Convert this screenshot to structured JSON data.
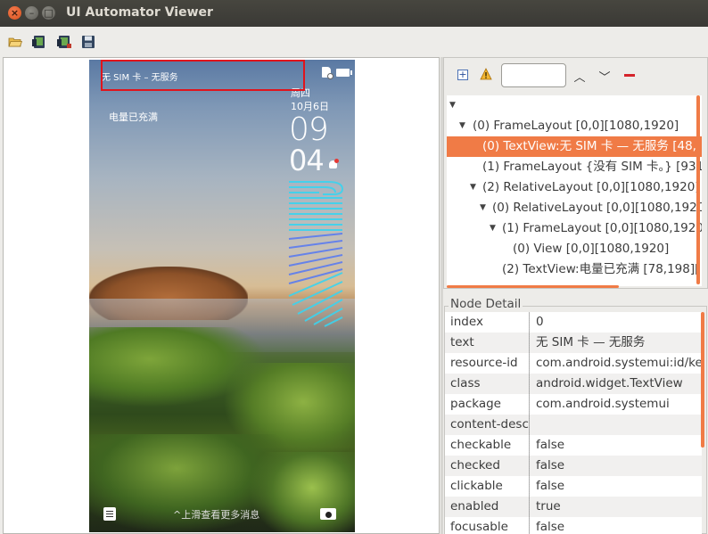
{
  "window": {
    "title": "UI Automator Viewer",
    "close_glyph": "×",
    "minimize_glyph": "–",
    "maximize_glyph": "□"
  },
  "toolbar": {
    "icons": [
      "open-folder-icon",
      "device-screenshot-icon",
      "device-screenshot-compressed-icon",
      "save-icon"
    ]
  },
  "device": {
    "status_text": "无 SIM 卡 – 无服务",
    "weekday": "周四",
    "date": "10月6日",
    "hour": "09",
    "minute": "04",
    "charge_text": "电量已充满",
    "swipe_hint": "^上滑查看更多消息"
  },
  "tree_toolbar": {
    "search_value": "",
    "prev_glyph": "︿",
    "next_glyph": "﹀"
  },
  "tree": {
    "root_glyph": "▼",
    "rows": [
      {
        "label": "(0) FrameLayout [0,0][1080,1920]",
        "tri": "▼",
        "selected": false
      },
      {
        "label": "(0) TextView:无 SIM 卡 — 无服务 [48,",
        "tri": "",
        "selected": true
      },
      {
        "label": "(1) FrameLayout {没有 SIM 卡。} [931",
        "tri": "",
        "selected": false
      },
      {
        "label": "(2) RelativeLayout [0,0][1080,1920]",
        "tri": "▼",
        "selected": false
      },
      {
        "label": "(0) RelativeLayout [0,0][1080,1920",
        "tri": "▼",
        "selected": false
      },
      {
        "label": "(1) FrameLayout [0,0][1080,1920]",
        "tri": "▼",
        "selected": false
      },
      {
        "label": "(0) View [0,0][1080,1920]",
        "tri": "",
        "selected": false
      },
      {
        "label": "(2) TextView:电量已充满 [78,198][",
        "tri": "",
        "selected": false
      }
    ]
  },
  "node_detail": {
    "legend": "Node Detail",
    "rows": [
      {
        "key": "index",
        "value": "0"
      },
      {
        "key": "text",
        "value": "无 SIM 卡 — 无服务"
      },
      {
        "key": "resource-id",
        "value": "com.android.systemui:id/ke"
      },
      {
        "key": "class",
        "value": "android.widget.TextView"
      },
      {
        "key": "package",
        "value": "com.android.systemui"
      },
      {
        "key": "content-desc",
        "value": ""
      },
      {
        "key": "checkable",
        "value": "false"
      },
      {
        "key": "checked",
        "value": "false"
      },
      {
        "key": "clickable",
        "value": "false"
      },
      {
        "key": "enabled",
        "value": "true"
      },
      {
        "key": "focusable",
        "value": "false"
      }
    ]
  },
  "colors": {
    "selection": "#f07b46",
    "highlight_box": "#e0141c"
  }
}
